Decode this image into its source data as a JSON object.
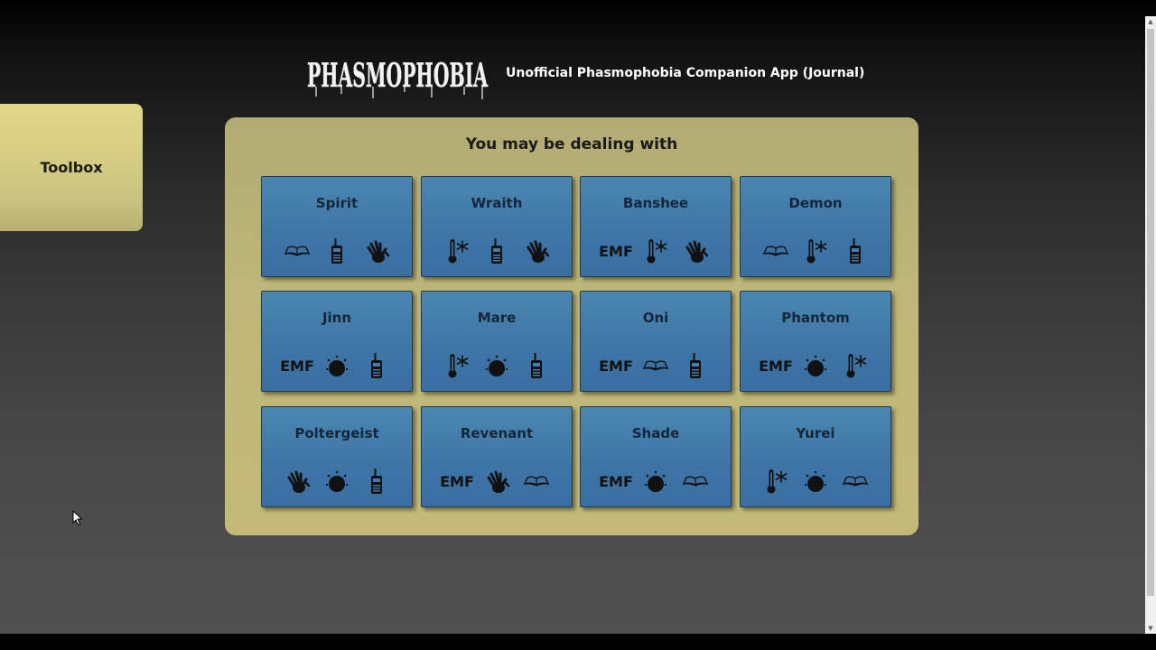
{
  "header": {
    "logo_text": "PHASMOPHOBIA",
    "app_title": "Unofficial Phasmophobia Companion App (Journal)"
  },
  "toolbox": {
    "label": "Toolbox"
  },
  "panel": {
    "title": "You may be dealing with"
  },
  "evidence_icons": {
    "emf": "EMF",
    "book": "ghost-writing-book-icon",
    "radio": "spirit-box-icon",
    "hand": "fingerprints-icon",
    "thermo": "freezing-temperatures-icon",
    "orb": "ghost-orb-icon"
  },
  "ghosts": [
    {
      "name": "Spirit",
      "evidence": [
        "book",
        "radio",
        "hand"
      ]
    },
    {
      "name": "Wraith",
      "evidence": [
        "thermo",
        "radio",
        "hand"
      ]
    },
    {
      "name": "Banshee",
      "evidence": [
        "emf",
        "thermo",
        "hand"
      ]
    },
    {
      "name": "Demon",
      "evidence": [
        "book",
        "thermo",
        "radio"
      ]
    },
    {
      "name": "Jinn",
      "evidence": [
        "emf",
        "orb",
        "radio"
      ]
    },
    {
      "name": "Mare",
      "evidence": [
        "thermo",
        "orb",
        "radio"
      ]
    },
    {
      "name": "Oni",
      "evidence": [
        "emf",
        "book",
        "radio"
      ]
    },
    {
      "name": "Phantom",
      "evidence": [
        "emf",
        "orb",
        "thermo"
      ]
    },
    {
      "name": "Poltergeist",
      "evidence": [
        "hand",
        "orb",
        "radio"
      ]
    },
    {
      "name": "Revenant",
      "evidence": [
        "emf",
        "hand",
        "book"
      ]
    },
    {
      "name": "Shade",
      "evidence": [
        "emf",
        "orb",
        "book"
      ]
    },
    {
      "name": "Yurei",
      "evidence": [
        "thermo",
        "orb",
        "book"
      ]
    }
  ],
  "colors": {
    "card_blue": "#3d75a6",
    "panel_khaki": "#bdb678",
    "toolbox_yellow": "#d6ce84"
  }
}
